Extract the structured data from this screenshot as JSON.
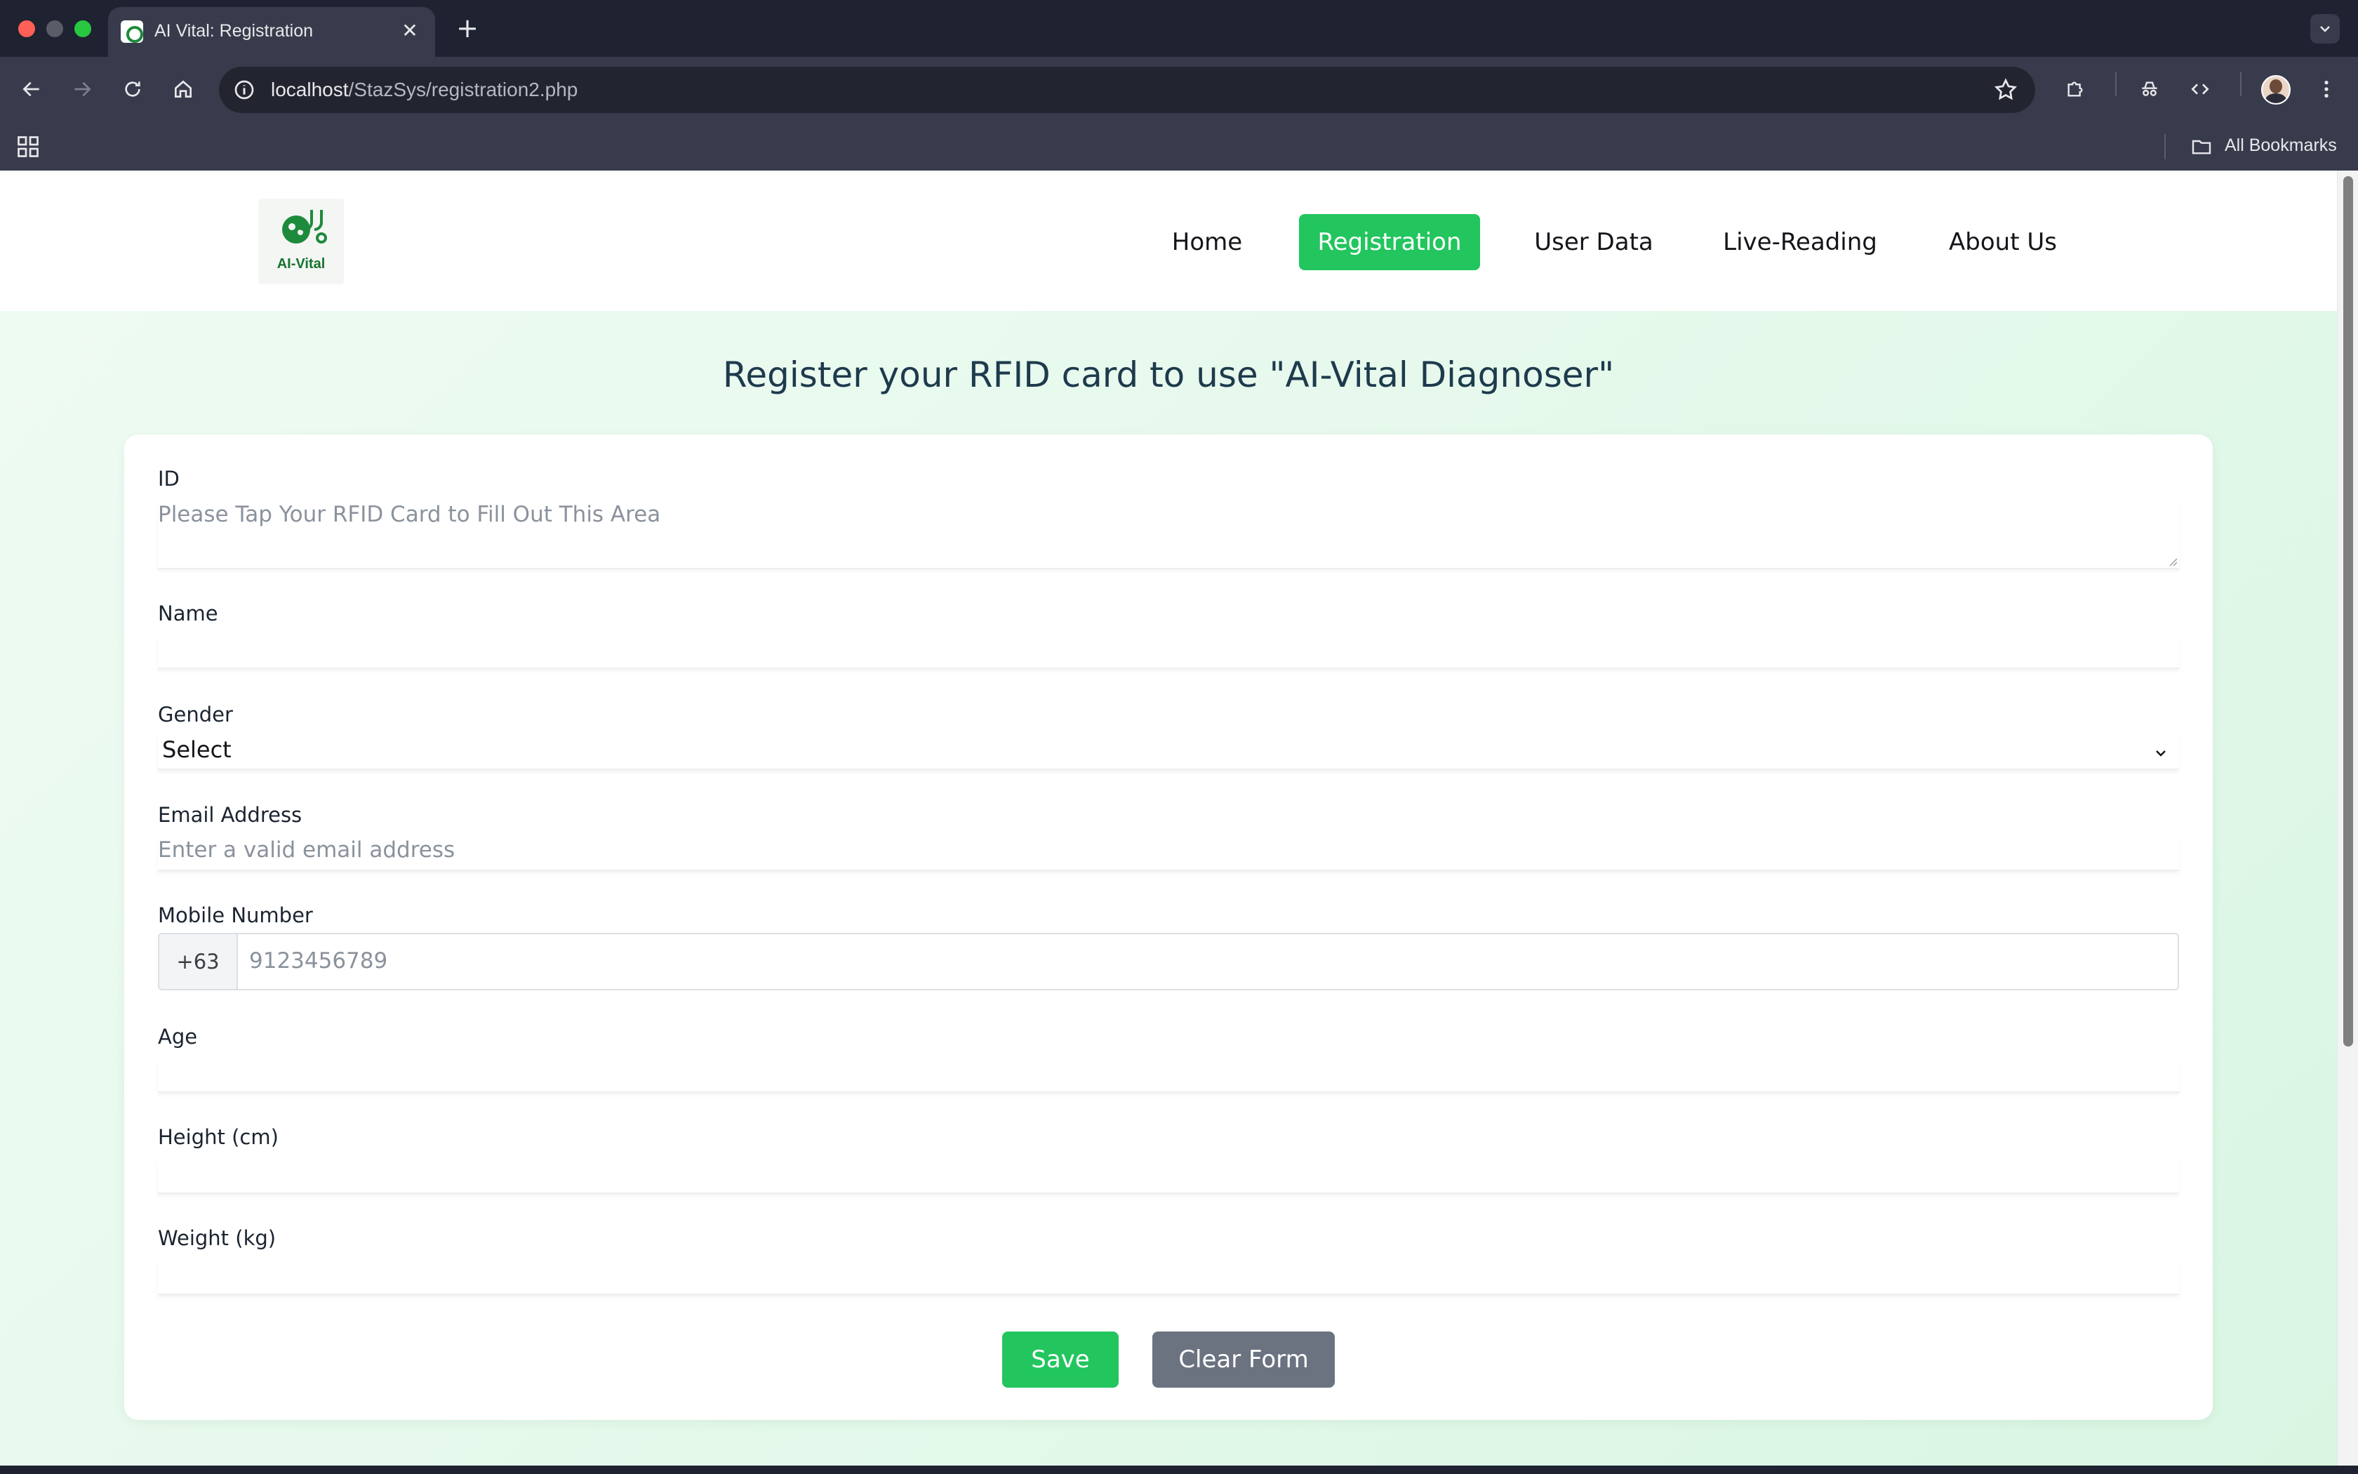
{
  "browser": {
    "tab_title": "AI Vital: Registration",
    "url_host": "localhost",
    "url_path": "/StazSys/registration2.php",
    "bookmarks_label": "All Bookmarks"
  },
  "site": {
    "logo_text": "AI-Vital",
    "nav": [
      {
        "label": "Home",
        "active": false
      },
      {
        "label": "Registration",
        "active": true
      },
      {
        "label": "User Data",
        "active": false
      },
      {
        "label": "Live-Reading",
        "active": false
      },
      {
        "label": "About Us",
        "active": false
      }
    ],
    "accent_color": "#22c55e"
  },
  "form": {
    "heading": "Register your RFID card to use \"AI-Vital Diagnoser\"",
    "id": {
      "label": "ID",
      "placeholder": "Please Tap Your RFID Card to Fill Out This Area",
      "value": ""
    },
    "name": {
      "label": "Name",
      "value": ""
    },
    "gender": {
      "label": "Gender",
      "selected": "Select"
    },
    "email": {
      "label": "Email Address",
      "placeholder": "Enter a valid email address",
      "value": ""
    },
    "mobile": {
      "label": "Mobile Number",
      "prefix": "+63",
      "placeholder": "9123456789",
      "value": ""
    },
    "age": {
      "label": "Age",
      "value": ""
    },
    "height": {
      "label": "Height (cm)",
      "value": ""
    },
    "weight": {
      "label": "Weight (kg)",
      "value": ""
    },
    "save_label": "Save",
    "clear_label": "Clear Form"
  }
}
